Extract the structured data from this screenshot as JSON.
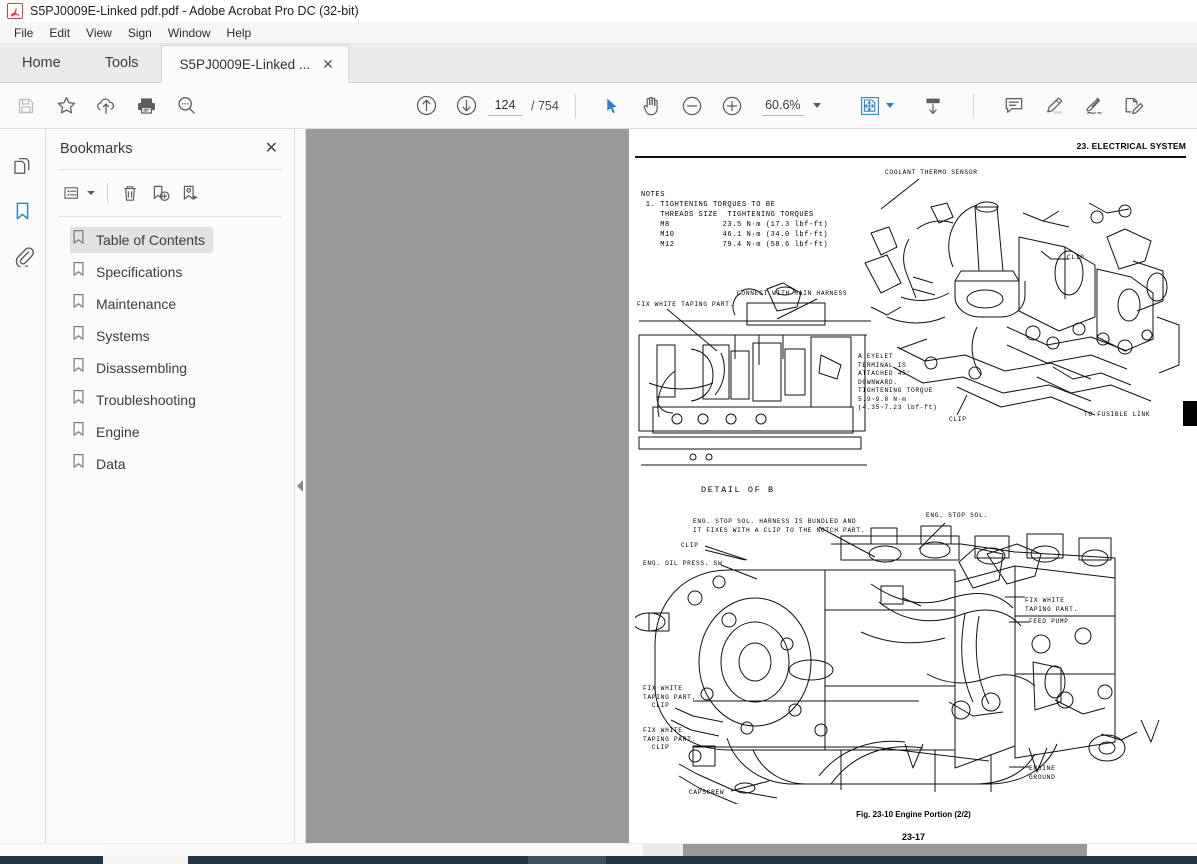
{
  "window": {
    "title": "S5PJ0009E-Linked pdf.pdf - Adobe Acrobat Pro DC (32-bit)",
    "app_icon": "acrobat-icon"
  },
  "menu": {
    "items": [
      "File",
      "Edit",
      "View",
      "Sign",
      "Window",
      "Help"
    ]
  },
  "tabs": {
    "home": "Home",
    "tools": "Tools",
    "document": "S5PJ0009E-Linked ...",
    "close_glyph": "✕"
  },
  "toolbar": {
    "left_tools": [
      {
        "name": "save-icon",
        "label": "Save",
        "disabled": true
      },
      {
        "name": "star-icon",
        "label": "Add to Favorites",
        "disabled": false
      },
      {
        "name": "cloud-upload-icon",
        "label": "Upload to Document Cloud",
        "disabled": false
      },
      {
        "name": "print-icon",
        "label": "Print File",
        "disabled": false
      },
      {
        "name": "search-icon",
        "label": "Find",
        "disabled": false
      }
    ],
    "previous_page": "previous-page-icon",
    "next_page": "next-page-icon",
    "page_number": "124",
    "page_total": "/ 754",
    "page_placeholder": "Page",
    "select_tool": "select-cursor-icon",
    "hand_tool": "hand-tool-icon",
    "zoom_out": "zoom-out-icon",
    "zoom_in": "zoom-in-icon",
    "zoom_level": "60.6%",
    "fit_page": "fit-page-icon",
    "scroll_mode": "page-display-icon",
    "right_tools": [
      {
        "name": "comment-icon",
        "label": "Comment"
      },
      {
        "name": "highlight-icon",
        "label": "Highlight Text"
      },
      {
        "name": "sign-icon",
        "label": "Fill & Sign"
      },
      {
        "name": "edit-pdf-icon",
        "label": "Edit PDF"
      }
    ]
  },
  "rail": {
    "items": [
      {
        "name": "page-thumbnails-icon",
        "label": "Page Thumbnails",
        "active": false
      },
      {
        "name": "bookmarks-icon",
        "label": "Bookmarks",
        "active": true
      },
      {
        "name": "attachments-icon",
        "label": "Attachments",
        "active": false
      }
    ]
  },
  "nav_panel": {
    "title": "Bookmarks",
    "close": "✕",
    "tools": [
      {
        "name": "bookmark-options-icon",
        "label": "Options"
      },
      {
        "name": "delete-bookmark-icon",
        "label": "Delete Bookmark"
      },
      {
        "name": "new-bookmark-icon",
        "label": "New Bookmark"
      },
      {
        "name": "find-bookmark-icon",
        "label": "Highlight Current Bookmark"
      }
    ],
    "bookmarks": [
      {
        "label": "Table of Contents",
        "selected": true
      },
      {
        "label": "Specifications",
        "selected": false
      },
      {
        "label": "Maintenance",
        "selected": false
      },
      {
        "label": "Systems",
        "selected": false
      },
      {
        "label": "Disassembling",
        "selected": false
      },
      {
        "label": "Troubleshooting",
        "selected": false
      },
      {
        "label": "Engine",
        "selected": false
      },
      {
        "label": "Data",
        "selected": false
      }
    ]
  },
  "page": {
    "header": "23. ELECTRICAL SYSTEM",
    "notes": "NOTES\n 1. TIGHTENING TORQUES TO BE\n    THREADS SIZE  TIGHTENING TORQUES\n    M8           23.5 N·m (17.3 lbf-ft)\n    M10          46.1 N·m (34.0 lbf-ft)\n    M12          79.4 N·m (58.6 lbf-ft)",
    "labels_top": [
      {
        "id": "coolant-thermo-sensor",
        "text": "COOLANT THERMO SENSOR"
      },
      {
        "id": "clip-top-right",
        "text": "CLIP"
      },
      {
        "id": "fix-white-taping-part-left",
        "text": "FIX WHITE TAPING PART."
      },
      {
        "id": "connect-with-main-harness",
        "text": "CONNECT WITH MAIN HARNESS"
      },
      {
        "id": "eyelet-terminal-note",
        "text": "A EYELET\nTERMINAL IS\nATTACHED 45°\nDOWNWARD.\nTIGHTENING TORQUE\n5.9~9.8 N·m\n(4.35~7.23 lbf-ft)"
      },
      {
        "id": "clip-mid",
        "text": "CLIP"
      },
      {
        "id": "to-fusible-link",
        "text": "TO FUSIBLE LINK"
      },
      {
        "id": "detail-of-b",
        "text": "DETAIL OF B"
      }
    ],
    "labels_bottom": [
      {
        "id": "eng-stop-sol-harness-note",
        "text": "ENG. STOP SOL. HARNESS IS BUNDLED AND\nIT FIXES WITH A CLIP TO THE NOTCH PART."
      },
      {
        "id": "eng-stop-sol",
        "text": "ENG. STOP SOL."
      },
      {
        "id": "clip-upper-left",
        "text": "CLIP"
      },
      {
        "id": "eng-oil-press-sw",
        "text": "ENG. OIL PRESS. SW"
      },
      {
        "id": "fix-white-taping-part-right",
        "text": "FIX WHITE\nTAPING PART."
      },
      {
        "id": "feed-pump",
        "text": "FEED PUMP"
      },
      {
        "id": "fix-white-taping-part-clip-1",
        "text": "FIX WHITE\nTAPING PART.\n  CLIP"
      },
      {
        "id": "fix-white-taping-part-clip-2",
        "text": "FIX WHITE\nTAPING PART.\n  CLIP"
      },
      {
        "id": "capscrew",
        "text": "CAPSCREW"
      },
      {
        "id": "engine-ground",
        "text": "ENGINE\nGROUND"
      }
    ],
    "figure_caption": "Fig. 23-10 Engine Portion (2/2)",
    "page_number": "23-17"
  },
  "colors": {
    "accent": "#2f7fd1",
    "viewport_bg": "#999999",
    "chrome_bg": "#fbfbfb",
    "tabstrip_bg": "#eceaea"
  }
}
